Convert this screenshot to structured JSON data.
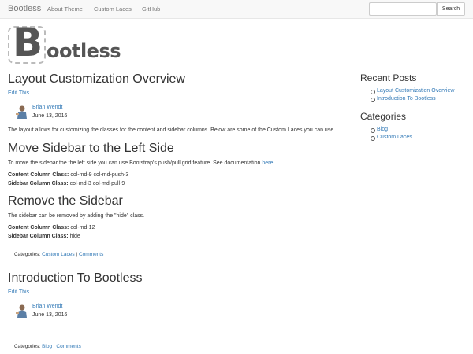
{
  "navbar": {
    "brand": "Bootless",
    "links": [
      "About Theme",
      "Custom Laces",
      "GitHub"
    ],
    "search_placeholder": "",
    "search_button": "Search"
  },
  "logo": {
    "first_letter": "B",
    "rest": "ootless"
  },
  "posts": [
    {
      "title": "Layout Customization Overview",
      "edit": "Edit This",
      "author": "Brian Wendt",
      "date": "June 13, 2016",
      "intro": "The layout allows for customizing the classes for the content and sidebar columns. Below are some of the Custom Laces you can use.",
      "sections": [
        {
          "heading": "Move Sidebar to the Left Side",
          "text": "To move the sidebar the the left side you can use Bootstrap's push/pull grid feature. See documentation",
          "link": "here",
          "trail": ".",
          "content_label": "Content Column Class:",
          "content_value": "col-md-9 col-md-push-3",
          "sidebar_label": "Sidebar Column Class:",
          "sidebar_value": "col-md-3 col-md-pull-9"
        },
        {
          "heading": "Remove the Sidebar",
          "text": "The sidebar can be removed by adding the \"hide\" class.",
          "content_label": "Content Column Class:",
          "content_value": "col-md-12",
          "sidebar_label": "Sidebar Column Class:",
          "sidebar_value": "hide"
        }
      ],
      "categories_label": "Categories:",
      "category": "Custom Laces",
      "separator": "|",
      "comments": "Comments"
    },
    {
      "title": "Introduction To Bootless",
      "edit": "Edit This",
      "author": "Brian Wendt",
      "date": "June 13, 2016",
      "categories_label": "Categories:",
      "category": "Blog",
      "separator": "|",
      "comments": "Comments"
    }
  ],
  "sidebar": {
    "recent_title": "Recent Posts",
    "recent_posts": [
      "Layout Customization Overview",
      "Introduction To Bootless"
    ],
    "categories_title": "Categories",
    "categories": [
      "Blog",
      "Custom Laces"
    ]
  },
  "colors": {
    "link": "#337ab7",
    "text": "#333333",
    "navbar_bg": "#f8f8f8"
  }
}
